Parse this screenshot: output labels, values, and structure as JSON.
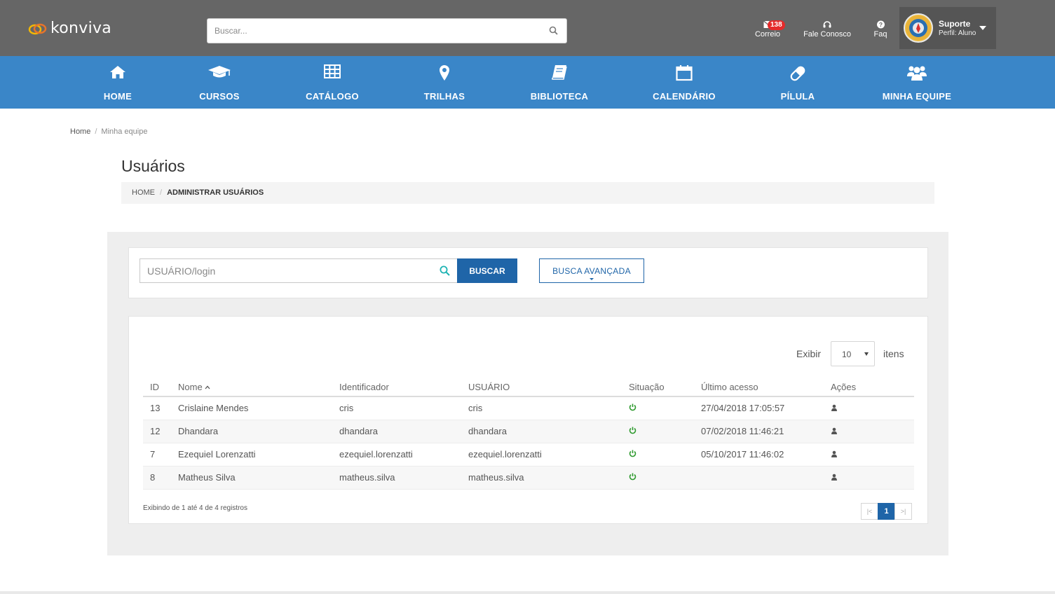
{
  "header": {
    "logo_text": "konviva",
    "search_placeholder": "Buscar...",
    "mail_label": "Correio",
    "mail_count": "138",
    "contact_label": "Fale Conosco",
    "faq_label": "Faq",
    "profile_name": "Suporte",
    "profile_role": "Perfil: Aluno"
  },
  "nav": {
    "items": [
      {
        "label": "HOME",
        "icon": "home-icon"
      },
      {
        "label": "CURSOS",
        "icon": "graduation-cap-icon"
      },
      {
        "label": "CATÁLOGO",
        "icon": "grid-icon"
      },
      {
        "label": "TRILHAS",
        "icon": "map-pin-icon"
      },
      {
        "label": "BIBLIOTECA",
        "icon": "book-icon"
      },
      {
        "label": "CALENDÁRIO",
        "icon": "calendar-icon"
      },
      {
        "label": "PÍLULA",
        "icon": "pill-icon"
      },
      {
        "label": "MINHA EQUIPE",
        "icon": "team-icon"
      }
    ]
  },
  "breadcrumb": {
    "home": "Home",
    "current": "Minha equipe"
  },
  "page": {
    "title": "Usuários",
    "crumb_home": "HOME",
    "crumb_current": "ADMINISTRAR USUÁRIOS"
  },
  "search": {
    "placeholder": "USUÁRIO/login",
    "button": "BUSCAR",
    "advanced": "BUSCA AVANÇADA"
  },
  "table": {
    "show_label": "Exibir",
    "page_size": "10",
    "items_label": "itens",
    "columns": [
      "ID",
      "Nome",
      "Identificador",
      "USUÁRIO",
      "Situação",
      "Último acesso",
      "Ações"
    ],
    "rows": [
      {
        "id": "13",
        "name": "Crislaine Mendes",
        "identifier": "cris",
        "user": "cris",
        "last_access": "27/04/2018 17:05:57"
      },
      {
        "id": "12",
        "name": "Dhandara",
        "identifier": "dhandara",
        "user": "dhandara",
        "last_access": "07/02/2018 11:46:21"
      },
      {
        "id": "7",
        "name": "Ezequiel Lorenzatti",
        "identifier": "ezequiel.lorenzatti",
        "user": "ezequiel.lorenzatti",
        "last_access": "05/10/2017 11:46:02"
      },
      {
        "id": "8",
        "name": "Matheus Silva",
        "identifier": "matheus.silva",
        "user": "matheus.silva",
        "last_access": ""
      }
    ],
    "footer_info": "Exibindo de 1 até 4 de 4 registros",
    "current_page": "1"
  },
  "colors": {
    "topbar": "#666666",
    "navbar": "#3a86c8",
    "primary_button": "#1f65a8",
    "status_active": "#2e9a2e",
    "badge": "#e52b2b"
  }
}
